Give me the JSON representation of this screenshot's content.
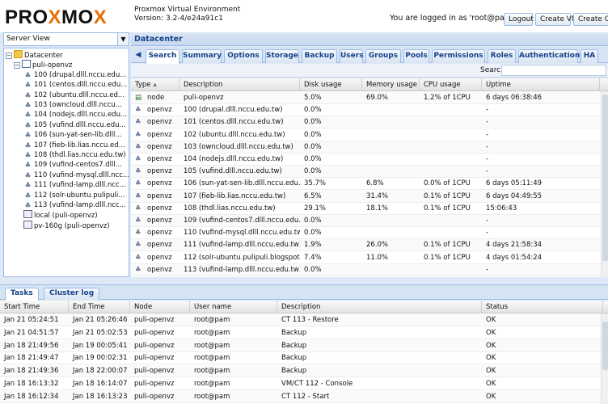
{
  "header": {
    "logo_prefix": "PRO",
    "logo_x": "X",
    "logo_mid": "MO",
    "logo_x2": "X",
    "env_title": "Proxmox Virtual Environment",
    "env_version": "Version: 3.2-4/e24a91c1",
    "login_text": "You are logged in as 'root@pam'",
    "logout_label": "Logout",
    "create_vm_label": "Create VM",
    "create_ct_label": "Create CT"
  },
  "server_view": {
    "selected": "Server View"
  },
  "tree": {
    "datacenter": "Datacenter",
    "node": "puli-openvz",
    "items": [
      {
        "label": "100 (drupal.dlll.nccu.edu..."
      },
      {
        "label": "101 (centos.dlll.nccu.edu..."
      },
      {
        "label": "102 (ubuntu.dlll.nccu.ed..."
      },
      {
        "label": "103 (owncloud.dlll.nccu..."
      },
      {
        "label": "104 (nodejs.dlll.nccu.edu..."
      },
      {
        "label": "105 (vufind.dlll.nccu.edu..."
      },
      {
        "label": "106 (sun-yat-sen-lib.dlll..."
      },
      {
        "label": "107 (fieb-lib.lias.nccu.ed..."
      },
      {
        "label": "108 (thdl.lias.nccu.edu.tw)"
      },
      {
        "label": "109 (vufind-centos7.dlll..."
      },
      {
        "label": "110 (vufind-mysql.dlll.ncc..."
      },
      {
        "label": "111 (vufind-lamp.dlll.ncc..."
      },
      {
        "label": "112 (solr-ubuntu.pulipuli..."
      },
      {
        "label": "113 (vufind-lamp.dlll.ncc..."
      }
    ],
    "storages": [
      {
        "label": "local (puli-openvz)"
      },
      {
        "label": "pv-160g (puli-openvz)"
      }
    ]
  },
  "panel": {
    "title": "Datacenter",
    "tabs": [
      {
        "label": "Search"
      },
      {
        "label": "Summary"
      },
      {
        "label": "Options"
      },
      {
        "label": "Storage"
      },
      {
        "label": "Backup"
      },
      {
        "label": "Users"
      },
      {
        "label": "Groups"
      },
      {
        "label": "Pools"
      },
      {
        "label": "Permissions"
      },
      {
        "label": "Roles"
      },
      {
        "label": "Authentication"
      },
      {
        "label": "HA"
      }
    ],
    "search_label": "Search:",
    "search_value": ""
  },
  "resource_grid": {
    "columns": [
      "Type",
      "Description",
      "Disk usage",
      "Memory usage",
      "CPU usage",
      "Uptime"
    ],
    "sort_indicator": "▴",
    "rows": [
      {
        "type": "node",
        "desc": "puli-openvz",
        "disk": "5.0%",
        "mem": "69.0%",
        "cpu": "1.2% of 1CPU",
        "uptime": "6 days 06:38:46"
      },
      {
        "type": "openvz",
        "desc": "100 (drupal.dlll.nccu.edu.tw)",
        "disk": "0.0%",
        "mem": "",
        "cpu": "",
        "uptime": "-"
      },
      {
        "type": "openvz",
        "desc": "101 (centos.dlll.nccu.edu.tw)",
        "disk": "0.0%",
        "mem": "",
        "cpu": "",
        "uptime": "-"
      },
      {
        "type": "openvz",
        "desc": "102 (ubuntu.dlll.nccu.edu.tw)",
        "disk": "0.0%",
        "mem": "",
        "cpu": "",
        "uptime": "-"
      },
      {
        "type": "openvz",
        "desc": "103 (owncloud.dlll.nccu.edu.tw)",
        "disk": "0.0%",
        "mem": "",
        "cpu": "",
        "uptime": "-"
      },
      {
        "type": "openvz",
        "desc": "104 (nodejs.dlll.nccu.edu.tw)",
        "disk": "0.0%",
        "mem": "",
        "cpu": "",
        "uptime": "-"
      },
      {
        "type": "openvz",
        "desc": "105 (vufind.dlll.nccu.edu.tw)",
        "disk": "0.0%",
        "mem": "",
        "cpu": "",
        "uptime": "-"
      },
      {
        "type": "openvz",
        "desc": "106 (sun-yat-sen-lib.dlll.nccu.edu.tw)",
        "disk": "35.7%",
        "mem": "6.8%",
        "cpu": "0.0% of 1CPU",
        "uptime": "6 days 05:11:49"
      },
      {
        "type": "openvz",
        "desc": "107 (fieb-lib.lias.nccu.edu.tw)",
        "disk": "6.5%",
        "mem": "31.4%",
        "cpu": "0.1% of 1CPU",
        "uptime": "6 days 04:49:55"
      },
      {
        "type": "openvz",
        "desc": "108 (thdl.lias.nccu.edu.tw)",
        "disk": "29.1%",
        "mem": "18.1%",
        "cpu": "0.1% of 1CPU",
        "uptime": "15:06:43"
      },
      {
        "type": "openvz",
        "desc": "109 (vufind-centos7.dlll.nccu.edu.tw)",
        "disk": "0.0%",
        "mem": "",
        "cpu": "",
        "uptime": "-"
      },
      {
        "type": "openvz",
        "desc": "110 (vufind-mysql.dlll.nccu.edu.tw)",
        "disk": "0.0%",
        "mem": "",
        "cpu": "",
        "uptime": "-"
      },
      {
        "type": "openvz",
        "desc": "111 (vufind-lamp.dlll.nccu.edu.tw)",
        "disk": "1.9%",
        "mem": "26.0%",
        "cpu": "0.1% of 1CPU",
        "uptime": "4 days 21:58:34"
      },
      {
        "type": "openvz",
        "desc": "112 (solr-ubuntu.pulipuli.blogspot.tw)",
        "disk": "7.4%",
        "mem": "11.0%",
        "cpu": "0.1% of 1CPU",
        "uptime": "4 days 01:54:24"
      },
      {
        "type": "openvz",
        "desc": "113 (vufind-lamp.dlll.nccu.edu.tw)",
        "disk": "0.0%",
        "mem": "",
        "cpu": "",
        "uptime": "-"
      }
    ]
  },
  "bottom": {
    "tabs": [
      {
        "label": "Tasks"
      },
      {
        "label": "Cluster log"
      }
    ],
    "columns": [
      "Start Time",
      "End Time",
      "Node",
      "User name",
      "Description",
      "Status"
    ],
    "rows": [
      {
        "start": "Jan 21 05:24:51",
        "end": "Jan 21 05:26:46",
        "node": "puli-openvz",
        "user": "root@pam",
        "desc": "CT 113 - Restore",
        "status": "OK"
      },
      {
        "start": "Jan 21 04:51:57",
        "end": "Jan 21 05:02:53",
        "node": "puli-openvz",
        "user": "root@pam",
        "desc": "Backup",
        "status": "OK"
      },
      {
        "start": "Jan 18 21:49:56",
        "end": "Jan 19 00:05:41",
        "node": "puli-openvz",
        "user": "root@pam",
        "desc": "Backup",
        "status": "OK"
      },
      {
        "start": "Jan 18 21:49:47",
        "end": "Jan 19 00:02:31",
        "node": "puli-openvz",
        "user": "root@pam",
        "desc": "Backup",
        "status": "OK"
      },
      {
        "start": "Jan 18 21:49:36",
        "end": "Jan 18 22:00:07",
        "node": "puli-openvz",
        "user": "root@pam",
        "desc": "Backup",
        "status": "OK"
      },
      {
        "start": "Jan 18 16:13:32",
        "end": "Jan 18 16:14:07",
        "node": "puli-openvz",
        "user": "root@pam",
        "desc": "VM/CT 112 - Console",
        "status": "OK"
      },
      {
        "start": "Jan 18 16:12:34",
        "end": "Jan 18 16:13:23",
        "node": "puli-openvz",
        "user": "root@pam",
        "desc": "CT 112 - Start",
        "status": "OK"
      }
    ]
  }
}
